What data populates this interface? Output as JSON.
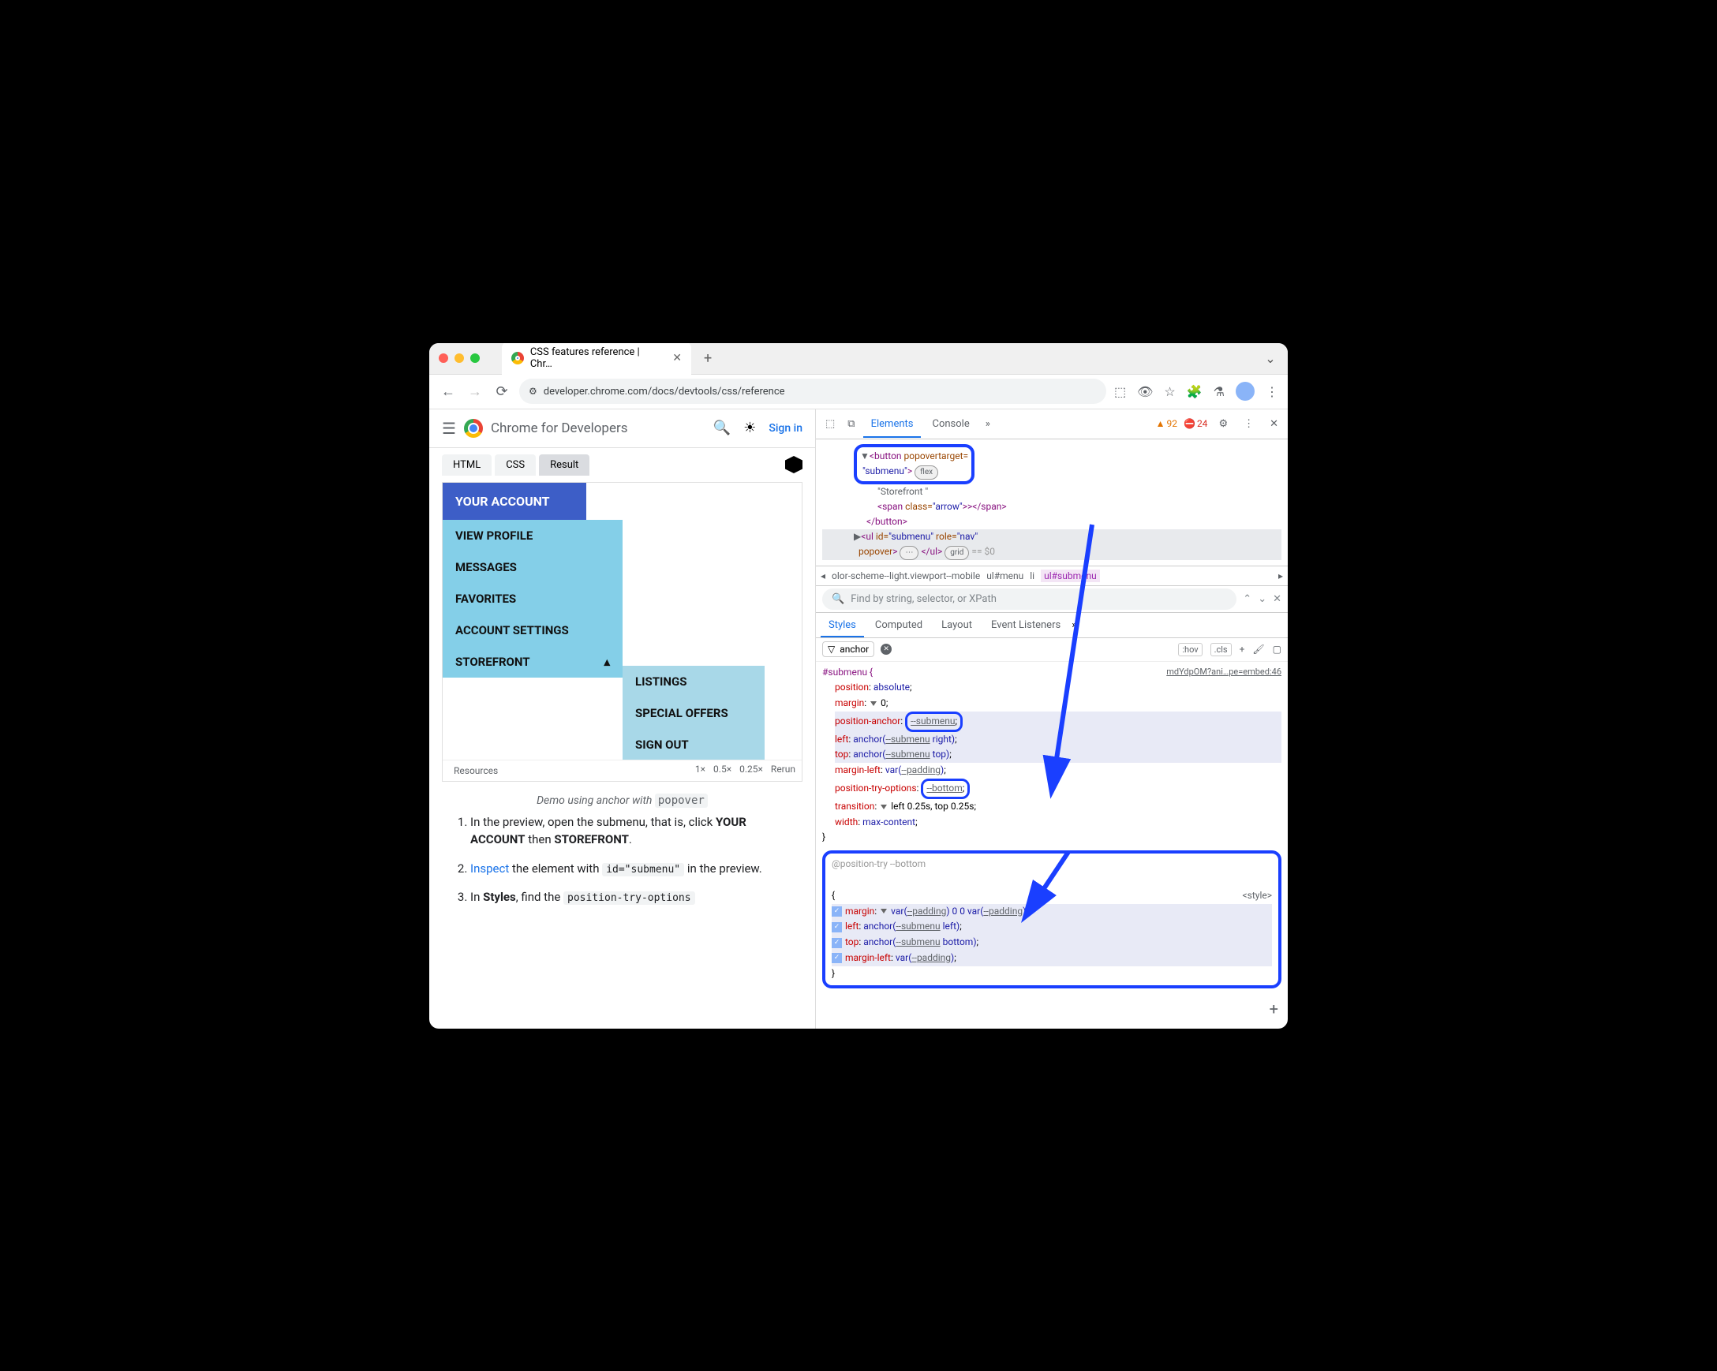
{
  "titlebar": {
    "tab_title": "CSS features reference | Chr…"
  },
  "toolbar": {
    "url": "developer.chrome.com/docs/devtools/css/reference"
  },
  "site": {
    "title": "Chrome for Developers",
    "signin": "Sign in"
  },
  "code_tabs": {
    "html": "HTML",
    "css": "CSS",
    "result": "Result"
  },
  "demo": {
    "header": "YOUR ACCOUNT",
    "items": [
      "VIEW PROFILE",
      "MESSAGES",
      "FAVORITES",
      "ACCOUNT SETTINGS",
      "STOREFRONT"
    ],
    "sub": [
      "LISTINGS",
      "SPECIAL OFFERS",
      "SIGN OUT"
    ],
    "footer": {
      "resources": "Resources",
      "z1": "1×",
      "z05": "0.5×",
      "z025": "0.25×",
      "rerun": "Rerun"
    }
  },
  "caption": {
    "text": "Demo using anchor with ",
    "code": "popover"
  },
  "steps": {
    "s1a": "In the preview, open the submenu, that is, click ",
    "s1b": "YOUR ACCOUNT",
    "s1c": " then ",
    "s1d": "STOREFRONT",
    "s1e": ".",
    "s2a": "Inspect",
    "s2b": " the element with ",
    "s2c": "id=\"submenu\"",
    "s2d": " in the preview.",
    "s3a": "In ",
    "s3b": "Styles",
    "s3c": ", find the ",
    "s3d": "position-try-options"
  },
  "devtools": {
    "tabs": {
      "elements": "Elements",
      "console": "Console"
    },
    "warn_count": "92",
    "err_count": "24",
    "dom": {
      "l1a": "<button",
      "l1b": "popovertarget=",
      "l2a": "\"submenu\"",
      "l2b": ">",
      "flex": "flex",
      "l3": "\"Storefront \"",
      "l4a": "<span",
      "l4b": "class=",
      "l4c": "\"arrow\"",
      "l4d": ">></span>",
      "l5": "</button>",
      "l6a": "<ul",
      "l6b": "id=",
      "l6c": "\"submenu\"",
      "l6d": "role=",
      "l6e": "\"nav\"",
      "l7a": "popover",
      "l7b": ">",
      "grid": "grid",
      "l7c": "</ul>",
      "l7d": " == $0"
    },
    "breadcrumb": {
      "b1": "olor-scheme--light.viewport--mobile",
      "b2": "ul#menu",
      "b3": "li",
      "b4": "ul#submenu"
    },
    "find_placeholder": "Find by string, selector, or XPath",
    "styles_tabs": {
      "styles": "Styles",
      "computed": "Computed",
      "layout": "Layout",
      "listeners": "Event Listeners"
    },
    "filter": "anchor",
    "toolbar_btns": {
      "hov": ":hov",
      "cls": ".cls"
    },
    "srclink": "mdYdpOM?ani…pe=embed:46",
    "rule": {
      "selector": "#submenu {",
      "p1": "position",
      "v1": "absolute",
      "p2": "margin",
      "v2": "0",
      "p3": "position-anchor",
      "v3": "--submenu",
      "p4": "left",
      "v4a": "anchor(",
      "v4b": "--submenu",
      "v4c": " right)",
      "p5": "top",
      "v5a": "anchor(",
      "v5b": "--submenu",
      "v5c": " top)",
      "p6": "margin-left",
      "v6a": "var(",
      "v6b": "--padding",
      "v6c": ")",
      "p7": "position-try-options",
      "v7": "--bottom",
      "p8": "transition",
      "v8": "left 0.25s, top 0.25s",
      "p9": "width",
      "v9": "max-content",
      "close": "}"
    },
    "try_rule": {
      "head": "@position-try --bottom",
      "open": "{",
      "src": "<style>",
      "p1": "margin",
      "v1a": "var(",
      "v1b": "--padding",
      "v1c": ") 0 0 var(",
      "v1d": "--padding",
      "v1e": ")",
      "p2": "left",
      "v2a": "anchor(",
      "v2b": "--submenu",
      "v2c": " left)",
      "p3": "top",
      "v3a": "anchor(",
      "v3b": "--submenu",
      "v3c": " bottom)",
      "p4": "margin-left",
      "v4a": "var(",
      "v4b": "--padding",
      "v4c": ")",
      "close": "}"
    }
  }
}
